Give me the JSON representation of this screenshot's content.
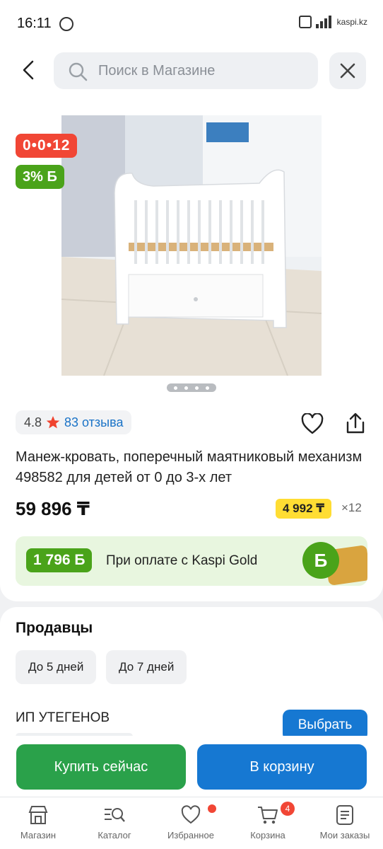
{
  "status_bar": {
    "time": "16:11",
    "carrier": "kaspi.kz"
  },
  "search": {
    "placeholder": "Поиск в Магазине"
  },
  "product": {
    "badge_countdown": "0•0•12",
    "badge_bonus": "3% Б",
    "gallery": {
      "count": 4,
      "active_index": 1
    },
    "rating": "4.8",
    "reviews": "83 отзыва",
    "title": "Манеж-кровать, поперечный маятниковый механизм 498582 для детей от 0 до 3-х лет",
    "price": "59 896 ₸",
    "installment": "4 992 ₸",
    "installment_months": "×12",
    "kaspi_gold": {
      "bonus": "1 796 Б",
      "text": "При оплате с Kaspi Gold",
      "coin": "Б"
    }
  },
  "sellers": {
    "title": "Продавцы",
    "delivery_chips": [
      "До 5 дней",
      "До 7 дней"
    ],
    "seller_name": "ИП УТЕГЕНОВ",
    "choose_label": "Выбрать"
  },
  "actions": {
    "buy_now": "Купить сейчас",
    "add_to_cart": "В корзину"
  },
  "nav": {
    "items": [
      {
        "label": "Магазин",
        "icon": "store-icon"
      },
      {
        "label": "Каталог",
        "icon": "catalog-search-icon"
      },
      {
        "label": "Избранное",
        "icon": "heart-icon"
      },
      {
        "label": "Корзина",
        "icon": "cart-icon",
        "badge": "4"
      },
      {
        "label": "Мои заказы",
        "icon": "orders-icon"
      }
    ]
  },
  "colors": {
    "accent_blue": "#1678d2",
    "buy_green": "#2aa14a",
    "bonus_green": "#4aa31a",
    "promo_red": "#f14635",
    "installment_yellow": "#ffdd33"
  }
}
